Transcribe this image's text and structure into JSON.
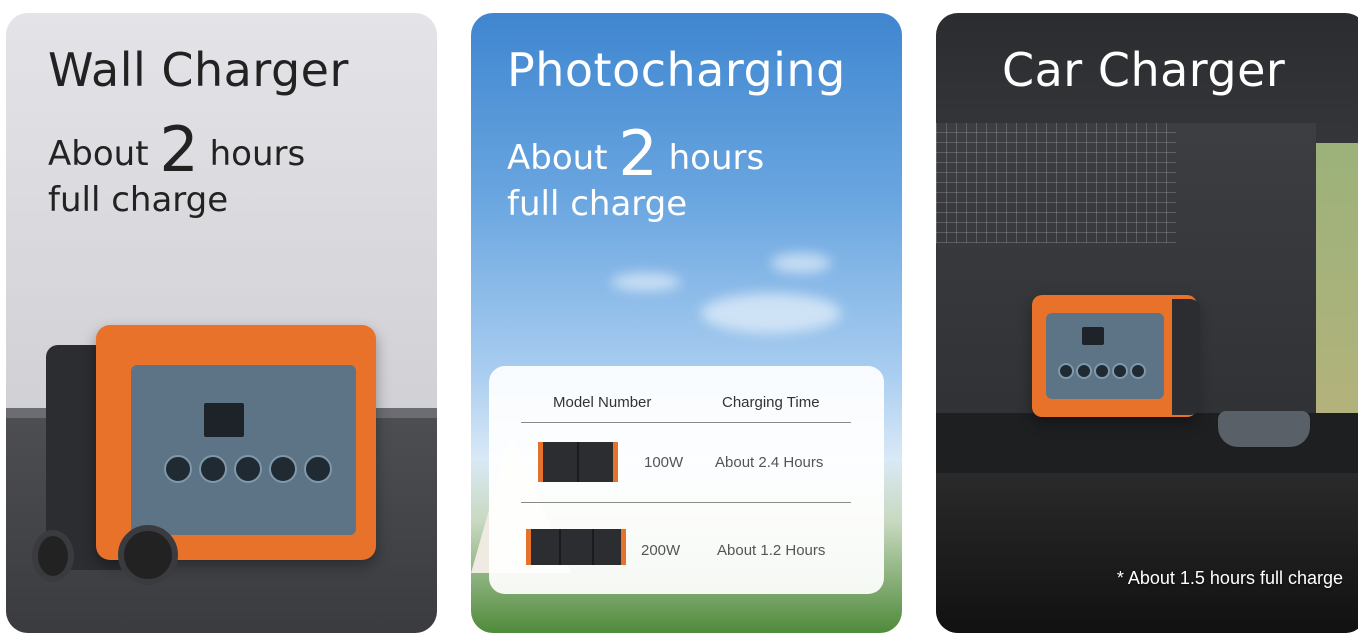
{
  "cards": {
    "wall": {
      "title": "Wall Charger",
      "sub_prefix": "About",
      "sub_number": "2",
      "sub_suffix": "hours",
      "sub_line2": "full charge"
    },
    "solar": {
      "title": "Photocharging",
      "sub_prefix": "About",
      "sub_number": "2",
      "sub_suffix": "hours",
      "sub_line2": "full charge",
      "table": {
        "headers": [
          "Model Number",
          "Charging Time"
        ],
        "rows": [
          {
            "model": "100W",
            "time": "About 2.4 Hours"
          },
          {
            "model": "200W",
            "time": "About 1.2 Hours"
          }
        ]
      }
    },
    "car": {
      "title": "Car Charger",
      "footnote": "* About 1.5 hours full charge"
    }
  },
  "colors": {
    "accent_orange": "#e8722a",
    "panel_blue_gray": "#5c7486"
  }
}
